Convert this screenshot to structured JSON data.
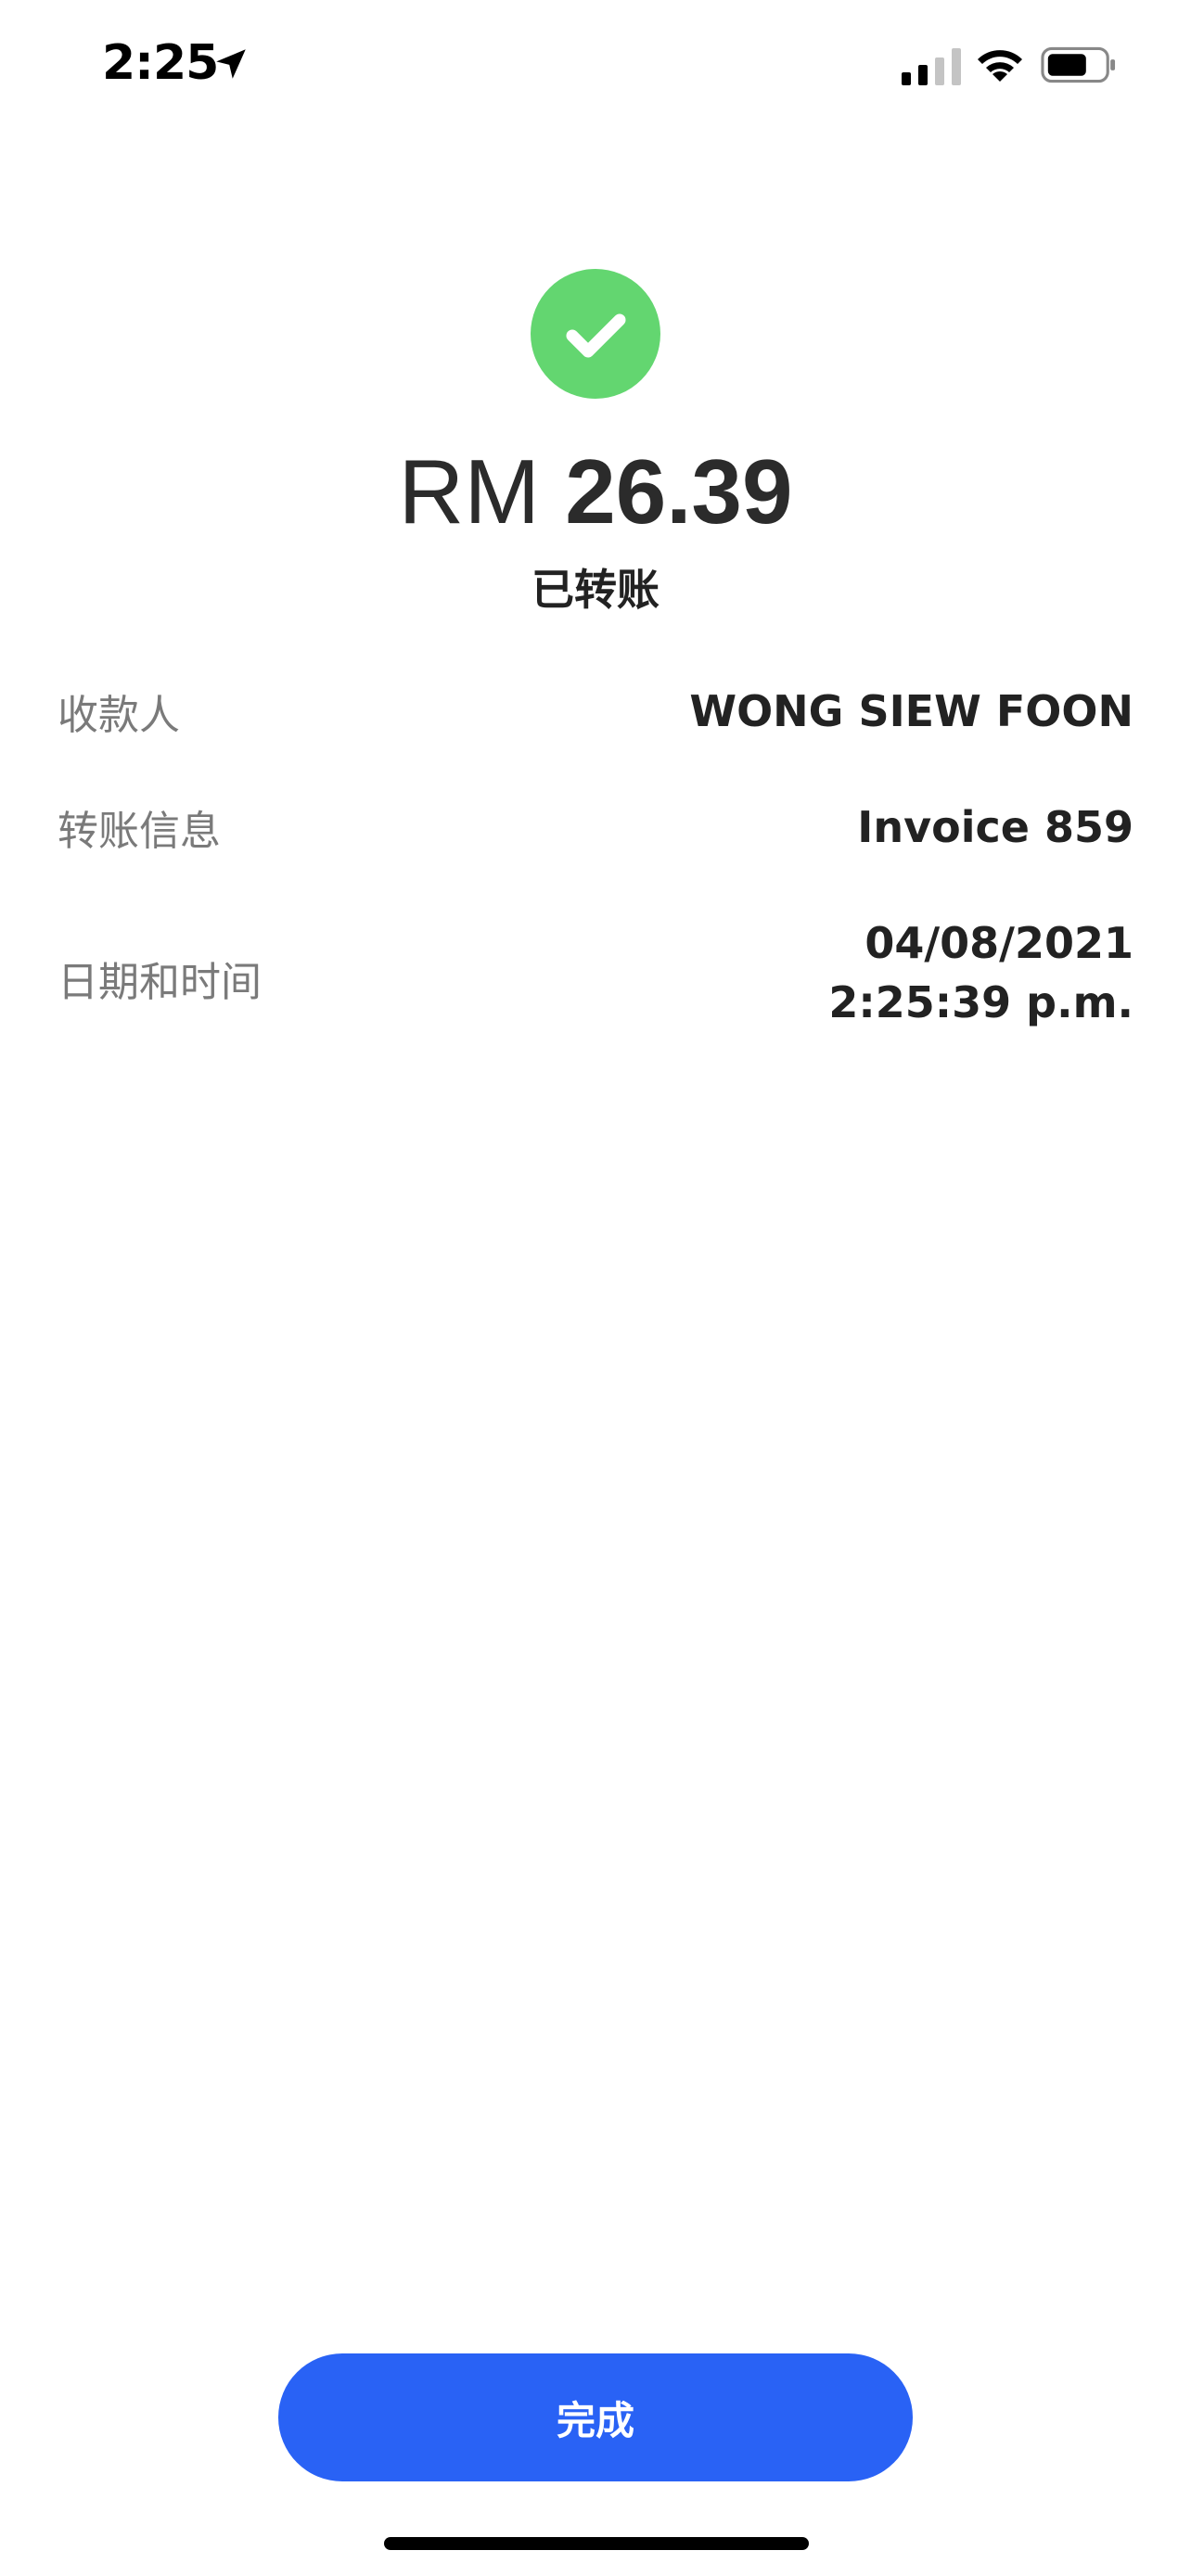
{
  "status_bar": {
    "time": "2:25",
    "location_icon": "location-arrow-icon",
    "signal_icon": "cellular-signal-icon",
    "wifi_icon": "wifi-icon",
    "battery_icon": "battery-icon"
  },
  "receipt": {
    "success_icon": "checkmark-icon",
    "success_color": "#63d670",
    "currency": "RM",
    "amount": "26.39",
    "status": "已转账",
    "details": {
      "recipient_label": "收款人",
      "recipient_value": "WONG SIEW FOON",
      "reference_label": "转账信息",
      "reference_value": "Invoice 859",
      "datetime_label": "日期和时间",
      "date_value": "04/08/2021",
      "time_value": "2:25:39 p.m."
    }
  },
  "footer": {
    "done_label": "完成",
    "button_color": "#2962f5"
  }
}
